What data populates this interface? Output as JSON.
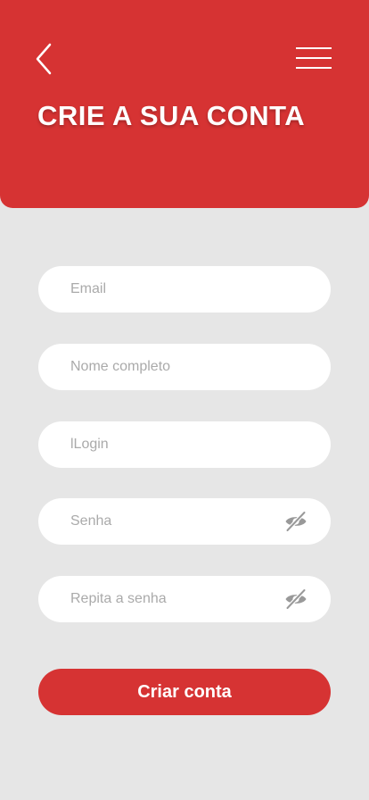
{
  "header": {
    "title": "CRIE A SUA CONTA",
    "back_icon": "chevron-left-icon",
    "menu_icon": "hamburger-menu-icon",
    "background_color": "#d63333"
  },
  "form": {
    "email_placeholder": "Email",
    "name_placeholder": "Nome completo",
    "login_placeholder": "lLogin",
    "password_placeholder": "Senha",
    "repeat_password_placeholder": "Repita a senha",
    "password_visibility_icon": "eye-slash-icon",
    "submit_label": "Criar conta"
  },
  "colors": {
    "accent": "#d63333",
    "page_background": "#e6e6e6",
    "field_background": "#ffffff",
    "placeholder": "#aaaaaa",
    "icon": "#999999"
  }
}
